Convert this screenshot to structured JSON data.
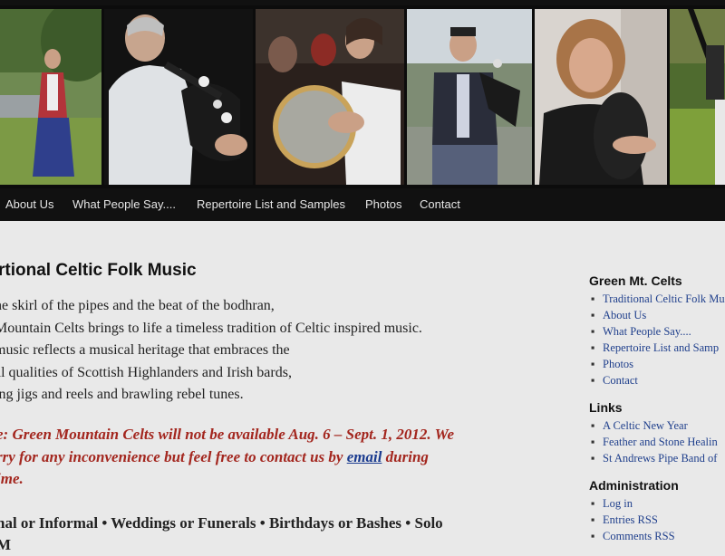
{
  "nav": {
    "items": [
      {
        "label": "About Us"
      },
      {
        "label": "What People Say...."
      },
      {
        "label": "Repertoire List and Samples"
      },
      {
        "label": "Photos"
      },
      {
        "label": "Contact"
      }
    ]
  },
  "main": {
    "title": "rtional Celtic Folk Music",
    "intro": [
      "he skirl of the pipes and the beat of the bodhran,",
      "Mountain Celts brings to life a timeless tradition of Celtic inspired music.",
      "music reflects a musical heritage that embraces the",
      "al qualities of Scottish Highlanders and Irish bards,",
      "ing jigs and reels and brawling rebel tunes."
    ],
    "notice": {
      "line1": "e: Green Mountain Celts will not be available Aug. 6 – Sept. 1, 2012. We",
      "line2_pre": "rry for any inconvenience but feel free to contact us by ",
      "link": "email",
      "line2_post": " during",
      "line3": "ime."
    },
    "events": {
      "line1": "nal or Informal • Weddings or Funerals • Birthdays or Bashes • Solo",
      "line2": "M"
    }
  },
  "sidebar": {
    "sections": [
      {
        "heading": "Green Mt. Celts",
        "items": [
          "Traditional Celtic Folk Mu",
          "About Us",
          "What People Say....",
          "Repertoire List and Samp",
          "Photos",
          "Contact"
        ]
      },
      {
        "heading": "Links",
        "items": [
          "A Celtic New Year",
          "Feather and Stone Healin",
          "St Andrews Pipe Band of"
        ]
      },
      {
        "heading": "Administration",
        "items": [
          "Log in",
          "Entries RSS",
          "Comments RSS"
        ]
      }
    ]
  },
  "banner": {
    "photos": [
      "woman-singer-outdoors",
      "bagpiper-white-shirt",
      "bodhran-drummer",
      "bagpiper-outdoors",
      "woman-bodhran-player",
      "bagpipes-field"
    ]
  }
}
